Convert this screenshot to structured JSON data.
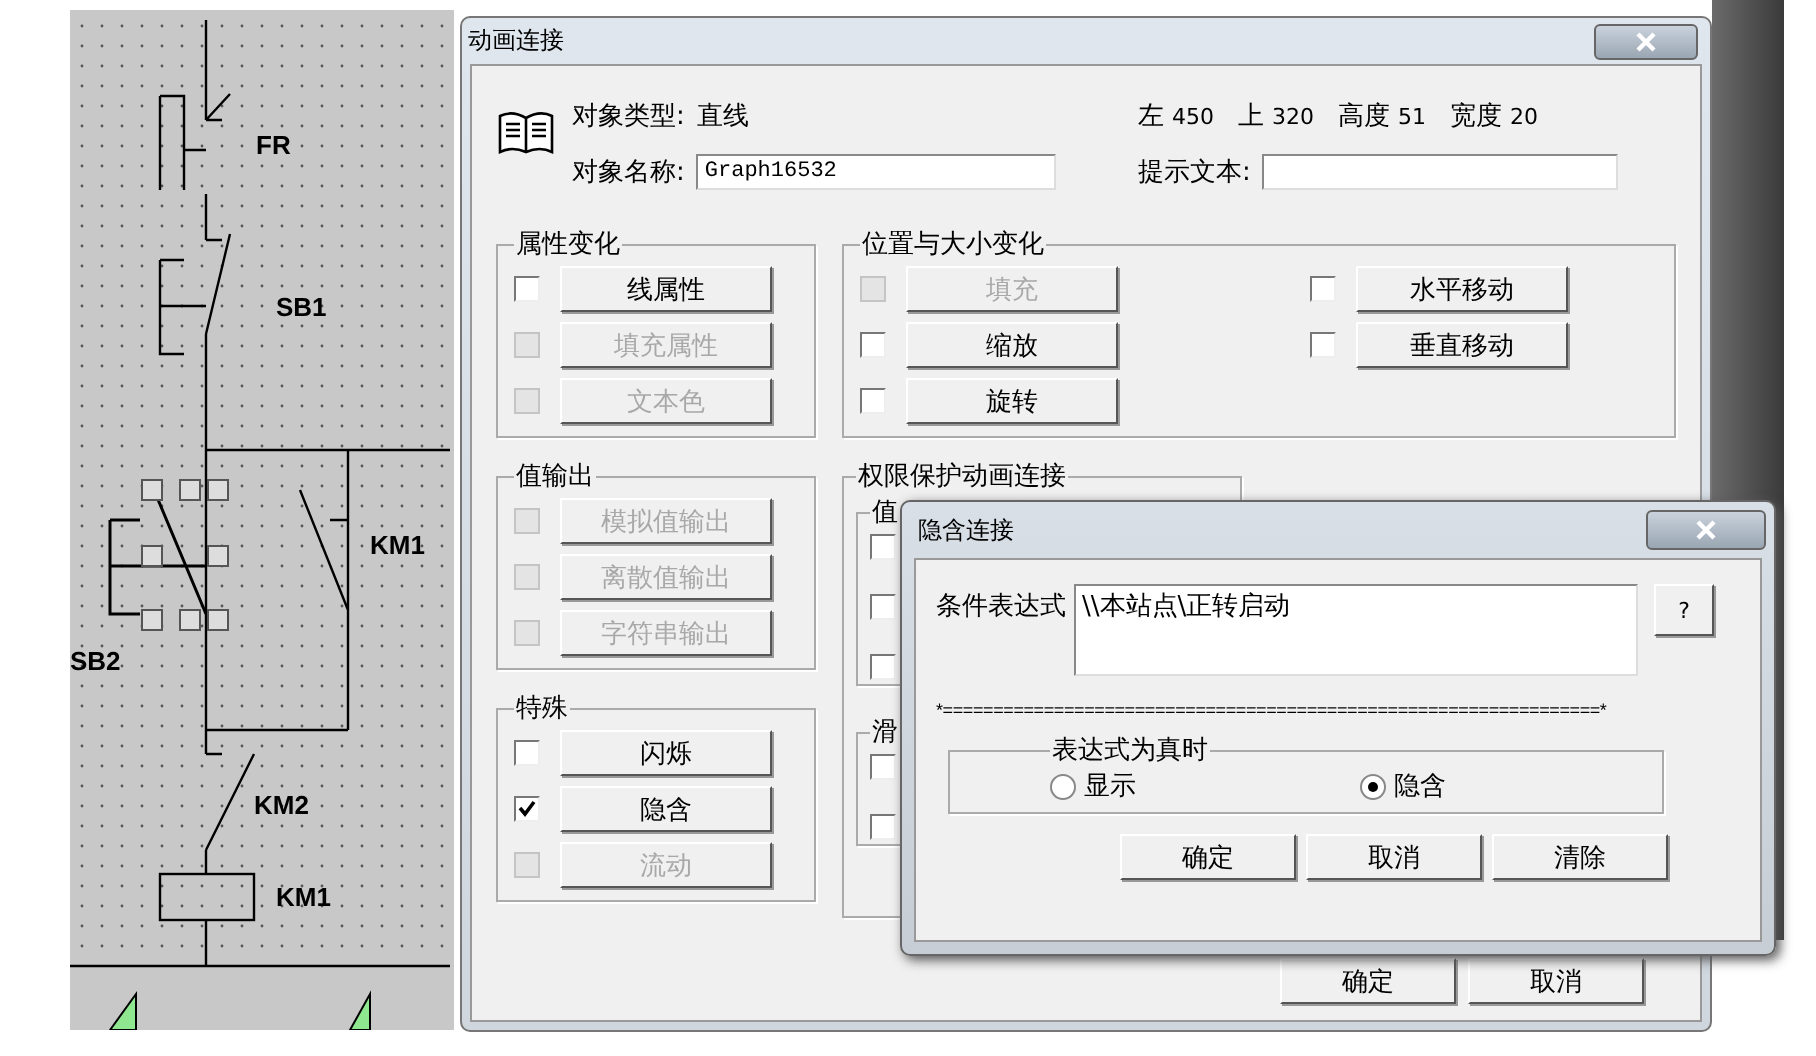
{
  "canvas": {
    "labels": [
      "FR",
      "SB1",
      "KM1",
      "SB2",
      "KM2",
      "KM1"
    ]
  },
  "dialog": {
    "title": "动画连接",
    "object_type_label": "对象类型:",
    "object_type": "直线",
    "object_name_label": "对象名称:",
    "object_name": "Graph16532",
    "geometry": [
      {
        "label": "左",
        "value": "450"
      },
      {
        "label": "上",
        "value": "320"
      },
      {
        "label": "高度",
        "value": "51"
      },
      {
        "label": "宽度",
        "value": "20"
      }
    ],
    "hint_label": "提示文本:",
    "attribute_group": {
      "title": "属性变化",
      "items": [
        {
          "label": "线属性",
          "checked": false,
          "disabled": false
        },
        {
          "label": "填充属性",
          "checked": false,
          "disabled": true
        },
        {
          "label": "文本色",
          "checked": false,
          "disabled": true
        }
      ]
    },
    "position_group": {
      "title": "位置与大小变化",
      "items": [
        {
          "label": "填充",
          "checked": false,
          "disabled": true
        },
        {
          "label": "缩放",
          "checked": false,
          "disabled": false
        },
        {
          "label": "旋转",
          "checked": false,
          "disabled": false
        },
        {
          "label": "水平移动",
          "checked": false,
          "disabled": false
        },
        {
          "label": "垂直移动",
          "checked": false,
          "disabled": false
        }
      ]
    },
    "value_output_group": {
      "title": "值输出",
      "items": [
        {
          "label": "模拟值输出",
          "checked": false,
          "disabled": true
        },
        {
          "label": "离散值输出",
          "checked": false,
          "disabled": true
        },
        {
          "label": "字符串输出",
          "checked": false,
          "disabled": true
        }
      ]
    },
    "special_group": {
      "title": "特殊",
      "items": [
        {
          "label": "闪烁",
          "checked": false,
          "disabled": false
        },
        {
          "label": "隐含",
          "checked": true,
          "disabled": false
        },
        {
          "label": "流动",
          "checked": false,
          "disabled": true
        }
      ]
    },
    "permission_group": {
      "title": "权限保护动画连接",
      "subgroups": [
        {
          "title": "值",
          "boxes": [
            {
              "checked": false
            },
            {
              "checked": false
            },
            {
              "checked": false
            }
          ]
        },
        {
          "title": "滑",
          "boxes": [
            {
              "checked": false
            },
            {
              "checked": false
            }
          ]
        }
      ]
    },
    "buttons": [
      "确定",
      "取消"
    ]
  },
  "popup": {
    "title": "隐含连接",
    "condition_label": "条件表达式",
    "condition": "\\\\本站点\\正转启动",
    "help": "?",
    "separator": "*=================================================================*",
    "group_title": "表达式为真时",
    "options": [
      {
        "label": "显示",
        "selected": false
      },
      {
        "label": "隐含",
        "selected": true
      }
    ],
    "buttons": [
      "确定",
      "取消",
      "清除"
    ]
  }
}
